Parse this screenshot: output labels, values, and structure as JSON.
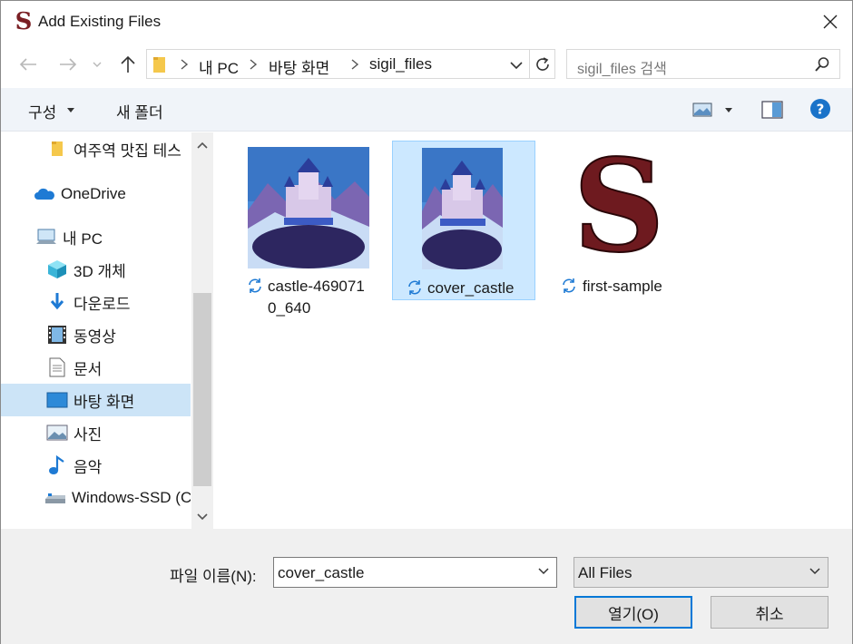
{
  "window": {
    "title": "Add Existing Files",
    "app_icon_letter": "S"
  },
  "nav": {
    "breadcrumb": [
      "내 PC",
      "바탕 화면",
      "sigil_files"
    ],
    "search_placeholder": "sigil_files 검색"
  },
  "toolbar": {
    "organize_label": "구성",
    "new_folder_label": "새 폴더"
  },
  "sidebar": {
    "items": [
      {
        "label": "여주역 맛집 테스",
        "icon": "folder-icon"
      },
      {
        "label": "OneDrive",
        "icon": "onedrive-icon"
      },
      {
        "label": "내 PC",
        "icon": "pc-icon"
      },
      {
        "label": "3D 개체",
        "icon": "3d-objects-icon"
      },
      {
        "label": "다운로드",
        "icon": "download-icon"
      },
      {
        "label": "동영상",
        "icon": "video-icon"
      },
      {
        "label": "문서",
        "icon": "document-icon"
      },
      {
        "label": "바탕 화면",
        "icon": "desktop-icon",
        "selected": true
      },
      {
        "label": "사진",
        "icon": "pictures-icon"
      },
      {
        "label": "음악",
        "icon": "music-icon"
      },
      {
        "label": "Windows-SSD (C",
        "icon": "drive-icon"
      }
    ]
  },
  "files": [
    {
      "line1": "castle-469071",
      "line2": "0_640",
      "selected": false
    },
    {
      "line1": "cover_castle",
      "line2": "",
      "selected": true
    },
    {
      "line1": "first-sample",
      "line2": "",
      "selected": false
    }
  ],
  "footer": {
    "filename_label": "파일 이름(N):",
    "filename_value": "cover_castle",
    "filter_value": "All Files",
    "open_label": "열기(O)",
    "cancel_label": "취소"
  },
  "colors": {
    "accent": "#0078d7",
    "selection": "#cce8ff",
    "toolbar_bg": "#f0f4f9",
    "footer_bg": "#f0f0f0"
  }
}
